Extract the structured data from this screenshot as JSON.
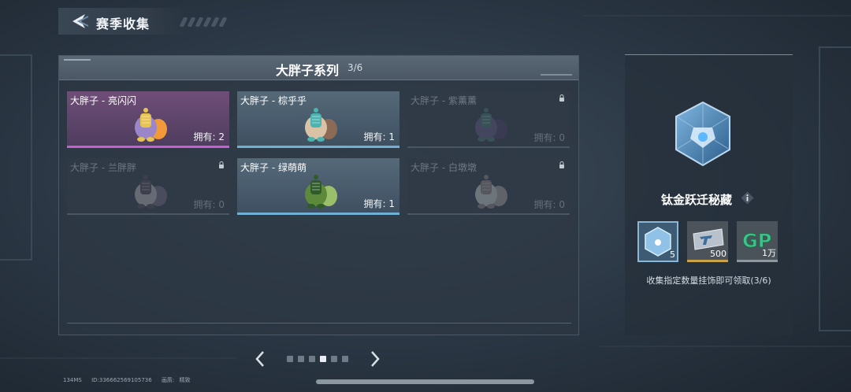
{
  "header": {
    "title": "赛季收集",
    "back_icon": "back-arrow-icon"
  },
  "series": {
    "title": "大胖子系列",
    "progress": "3/6",
    "items": [
      {
        "name": "大胖子 - 亮闪闪",
        "owned": "拥有: 2",
        "state": "owned",
        "rarity": "purple",
        "colors": [
          "#9a86c9",
          "#e7c44f",
          "#f29a3a"
        ]
      },
      {
        "name": "大胖子 - 棕乎乎",
        "owned": "拥有: 1",
        "state": "owned",
        "rarity": "blue",
        "colors": [
          "#d9c2a6",
          "#4bb4b0",
          "#8b6b55"
        ]
      },
      {
        "name": "大胖子 - 紫薰薰",
        "owned": "拥有: 0",
        "state": "locked",
        "rarity": "locked",
        "colors": [
          "#6b5a8c",
          "#4a7d7a",
          "#4a3d66"
        ]
      },
      {
        "name": "大胖子 - 兰胖胖",
        "owned": "拥有: 0",
        "state": "locked",
        "rarity": "locked",
        "colors": [
          "#c9c4c8",
          "#5a4a5c",
          "#7a6f8a"
        ]
      },
      {
        "name": "大胖子 - 绿萌萌",
        "owned": "拥有: 1",
        "state": "owned",
        "rarity": "blue",
        "colors": [
          "#5c8a3a",
          "#2f5a2a",
          "#9abf6a"
        ]
      },
      {
        "name": "大胖子 - 白墩墩",
        "owned": "拥有: 0",
        "state": "locked",
        "rarity": "locked",
        "colors": [
          "#e2e2e2",
          "#9e8f8a",
          "#b8b0aa"
        ]
      }
    ]
  },
  "pager": {
    "pages": 6,
    "current": 4
  },
  "reward": {
    "title": "钛金跃迁秘藏",
    "items": [
      {
        "icon": "titanium-crate-icon",
        "count": "5"
      },
      {
        "icon": "ticket-icon",
        "count": "500"
      },
      {
        "icon": "gp-icon",
        "count": "1万",
        "label": "GP"
      }
    ],
    "description": "收集指定数量挂饰即可领取(3/6)"
  },
  "footer": {
    "ping": "134MS",
    "id": "ID:336662569105736",
    "quality_label": "画质:",
    "quality": "精致"
  },
  "colors": {
    "accent_blue": "#6fb0d4",
    "rarity_purple": "#c65fd2",
    "gold": "#c9a347"
  }
}
